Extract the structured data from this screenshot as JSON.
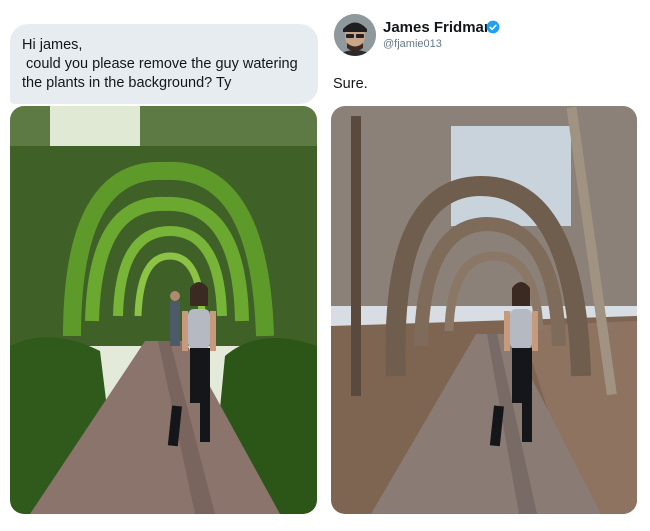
{
  "request": {
    "lines": [
      "Hi james,",
      " could you please remove the guy watering",
      "the plants in the background? Ty"
    ]
  },
  "author": {
    "name": "James Fridman",
    "handle": "@fjamie013",
    "verified": true,
    "avatar_icon": "avatar-photo"
  },
  "reply": {
    "text": "Sure."
  },
  "photos": {
    "original": "photo-garden-arches-original",
    "edited": "photo-garden-arches-edited"
  },
  "colors": {
    "bubble": "#e6ecf0",
    "verified": "#1da1f2",
    "handle": "#657786"
  }
}
